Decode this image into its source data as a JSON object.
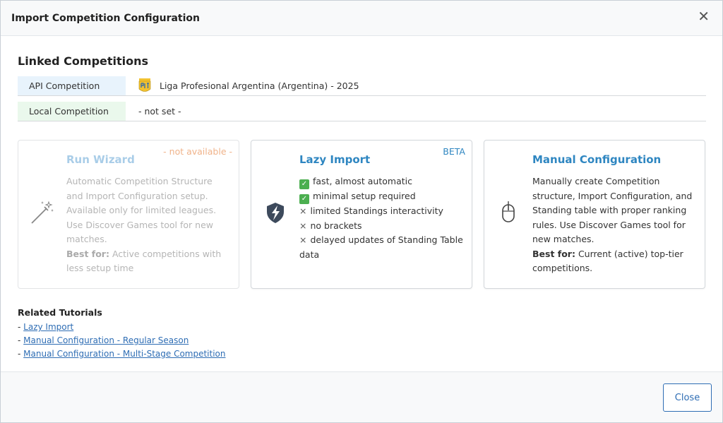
{
  "modal": {
    "title": "Import Competition Configuration",
    "close_label": "Close"
  },
  "linked": {
    "title": "Linked Competitions",
    "api_label": "API Competition",
    "api_value": "Liga Profesional Argentina (Argentina) - 2025",
    "local_label": "Local Competition",
    "local_value": "- not set -"
  },
  "cards": {
    "wizard": {
      "title": "Run Wizard",
      "tag": "- not available -",
      "desc": "Automatic Competition Structure and Import Configuration setup. Available only for limited leagues. Use Discover Games tool for new matches.",
      "best_label": "Best for:",
      "best_text": " Active competitions with less setup time",
      "icon": "magic-wand-icon"
    },
    "lazy": {
      "title": "Lazy Import",
      "tag": "BETA",
      "pros": [
        "fast, almost automatic",
        "minimal setup required"
      ],
      "cons": [
        "limited Standings interactivity",
        "no brackets",
        "delayed updates of Standing Table data"
      ],
      "icon": "shield-bolt-icon"
    },
    "manual": {
      "title": "Manual Configuration",
      "desc": "Manually create Competition structure, Import Configuration, and Standing table with proper ranking rules. Use Discover Games tool for new matches.",
      "best_label": "Best for:",
      "best_text": " Current (active) top-tier competitions.",
      "icon": "mouse-icon"
    }
  },
  "tutorials": {
    "title": "Related Tutorials",
    "prefix": "- ",
    "links": [
      "Lazy Import",
      "Manual Configuration - Regular Season",
      "Manual Configuration - Multi-Stage Competition"
    ]
  },
  "colors": {
    "accent": "#2e86c1",
    "api_bg": "#e8f3fc",
    "local_bg": "#eaf8ec",
    "not_available": "#f0b38a"
  }
}
